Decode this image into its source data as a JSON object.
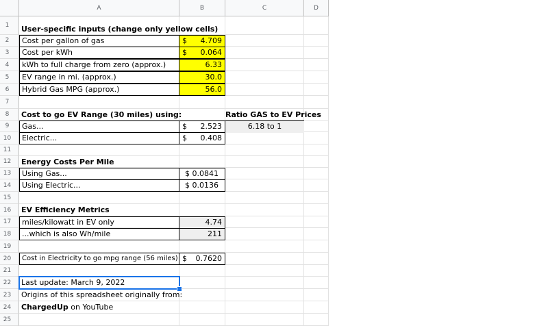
{
  "columns": [
    "A",
    "B",
    "C",
    "D"
  ],
  "rows": [
    "1",
    "2",
    "3",
    "4",
    "5",
    "6",
    "7",
    "8",
    "9",
    "10",
    "11",
    "12",
    "13",
    "14",
    "15",
    "16",
    "17",
    "18",
    "19",
    "20",
    "21",
    "22",
    "23",
    "24",
    "25"
  ],
  "inputs": {
    "header": "User-specific inputs (change only yellow cells)",
    "gas_label": "Cost per gallon of gas",
    "gas_cur": "$",
    "gas_val": "4.709",
    "kwh_label": "Cost per kWh",
    "kwh_cur": "$",
    "kwh_val": "0.064",
    "charge_label": "kWh to full charge from zero (approx.)",
    "charge_val": "6.33",
    "range_label": "EV range in mi. (approx.)",
    "range_val": "30.0",
    "mpg_label": "Hybrid Gas MPG (approx.)",
    "mpg_val": "56.0"
  },
  "range_cost": {
    "header": "Cost to go EV Range (30 miles) using:",
    "gas_label": "Gas...",
    "gas_cur": "$",
    "gas_val": "2.523",
    "elec_label": "Electric...",
    "elec_cur": "$",
    "elec_val": "0.408",
    "ratio_header": "Ratio GAS to EV Prices",
    "ratio_val": "6.18 to 1"
  },
  "per_mile": {
    "header": "Energy Costs Per Mile",
    "gas_label": "Using Gas...",
    "gas_val": "$ 0.0841",
    "elec_label": "Using Electric...",
    "elec_val": "$ 0.0136"
  },
  "efficiency": {
    "header": "EV Efficiency Metrics",
    "mpk_label": "miles/kilowatt in EV only",
    "mpk_val": "4.74",
    "wh_label": "...which is also Wh/mile",
    "wh_val": "211"
  },
  "mpg_range": {
    "label": "Cost in Electricity to go mpg range (56 miles)",
    "cur": "$",
    "val": "0.7620"
  },
  "footer": {
    "update": "Last update: March 9, 2022",
    "origins": "Origins of this spreadsheet originally from:",
    "source_bold": "ChargedUp",
    "source_rest": " on YouTube"
  }
}
